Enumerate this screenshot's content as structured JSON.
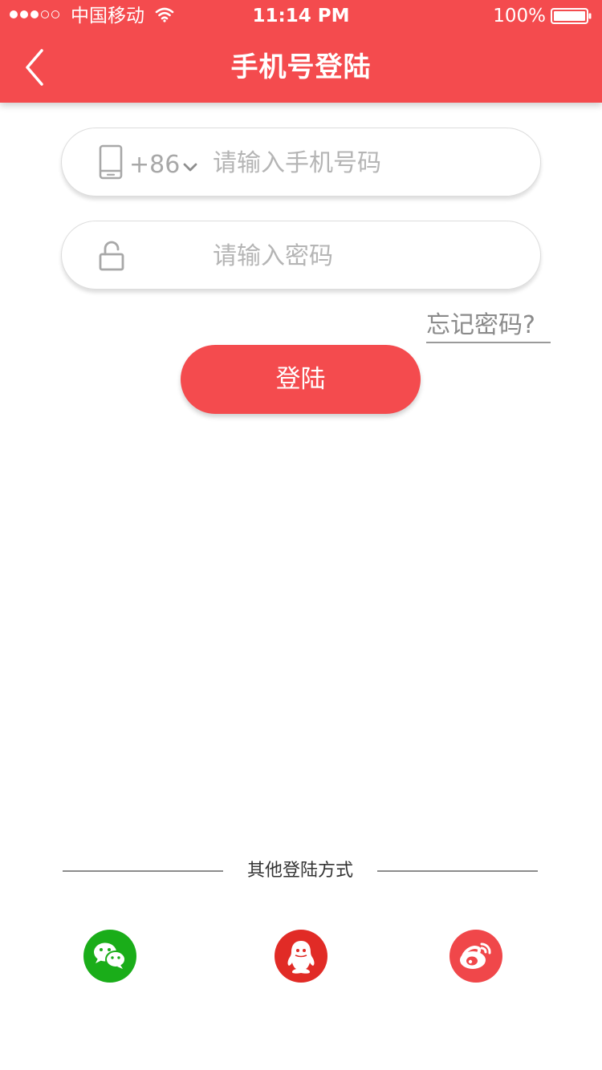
{
  "colors": {
    "brand": "#f44b4e",
    "wechat": "#1aad19",
    "qq": "#e12b26",
    "weibo": "#f0474a"
  },
  "status_bar": {
    "carrier": "中国移动",
    "time": "11:14 PM",
    "battery": "100%",
    "signal_icon": "signal-icon",
    "wifi_icon": "wifi-icon",
    "battery_icon": "battery-icon"
  },
  "nav": {
    "back_icon": "chevron-left-icon",
    "title": "手机号登陆"
  },
  "phone_field": {
    "icon": "phone-icon",
    "country_code": "+86",
    "dropdown_icon": "chevron-down-icon",
    "placeholder": "请输入手机号码",
    "value": ""
  },
  "password_field": {
    "icon": "lock-icon",
    "placeholder": "请输入密码",
    "value": ""
  },
  "forgot_password": "忘记密码?",
  "login_button": "登陆",
  "other_login": {
    "label": "其他登陆方式",
    "providers": [
      {
        "name": "wechat",
        "icon": "wechat-icon"
      },
      {
        "name": "qq",
        "icon": "qq-icon"
      },
      {
        "name": "weibo",
        "icon": "weibo-icon"
      }
    ]
  }
}
